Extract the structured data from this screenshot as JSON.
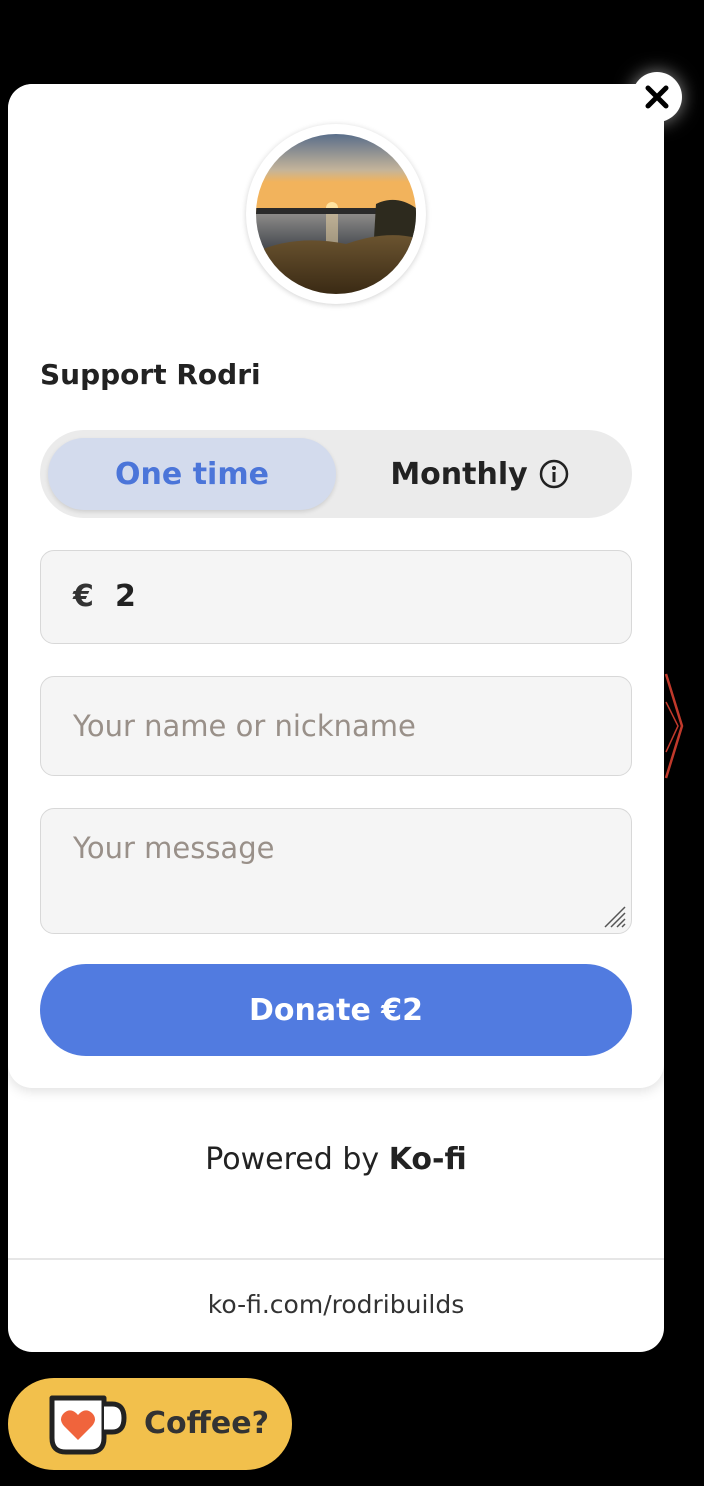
{
  "widget": {
    "title": "Support Rodri",
    "toggle": {
      "one_time_label": "One time",
      "monthly_label": "Monthly",
      "selected": "One time"
    },
    "amount": {
      "currency_symbol": "€",
      "value": "2"
    },
    "name_field": {
      "placeholder": "Your name or nickname"
    },
    "message_field": {
      "placeholder": "Your message"
    },
    "donate_label": "Donate €2",
    "powered_prefix": "Powered by",
    "powered_brand": "Ko-fi",
    "url": "ko-fi.com/rodribuilds"
  },
  "floating_button": {
    "label": "Coffee?"
  },
  "icons": {
    "close": "close-icon",
    "info": "info-icon",
    "cup": "kofi-cup-heart-icon",
    "resize": "resize-handle-icon"
  },
  "colors": {
    "accent": "#517be0",
    "toggle_selected_bg": "#d3dbed",
    "toggle_selected_text": "#4b75d9",
    "coffee_button": "#f2c04c",
    "heart": "#f0643c"
  }
}
